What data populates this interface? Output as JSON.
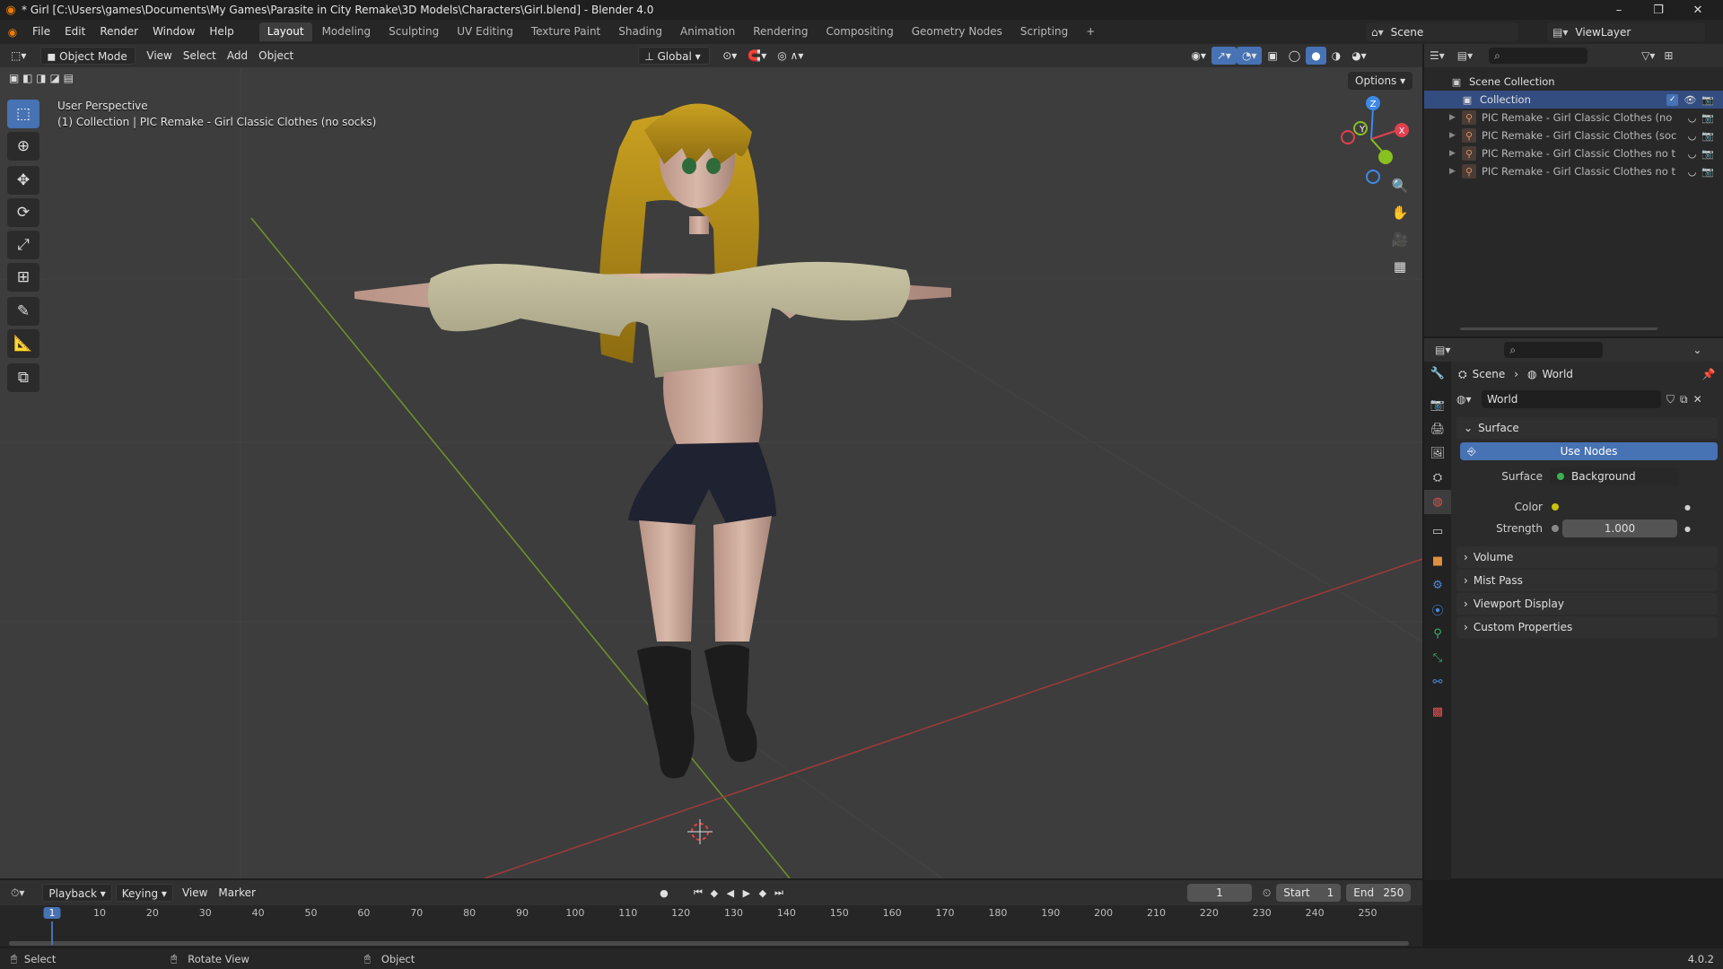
{
  "window": {
    "title": "* Girl [C:\\Users\\games\\Documents\\My Games\\Parasite in City Remake\\3D Models\\Characters\\Girl.blend] - Blender 4.0",
    "minimize": "–",
    "maximize": "❐",
    "close": "✕"
  },
  "menu": [
    "File",
    "Edit",
    "Render",
    "Window",
    "Help"
  ],
  "workspaces": [
    "Layout",
    "Modeling",
    "Sculpting",
    "UV Editing",
    "Texture Paint",
    "Shading",
    "Animation",
    "Rendering",
    "Compositing",
    "Geometry Nodes",
    "Scripting",
    "+"
  ],
  "active_workspace": "Layout",
  "scene_field": "Scene",
  "viewlayer_field": "ViewLayer",
  "viewport": {
    "mode": "Object Mode",
    "menus": [
      "View",
      "Select",
      "Add",
      "Object"
    ],
    "orientation": "Global",
    "options": "Options",
    "info_line1": "User Perspective",
    "info_line2": "(1) Collection | PIC Remake - Girl Classic Clothes (no socks)",
    "gizmo": {
      "x": "X",
      "y": "Y",
      "z": "Z"
    }
  },
  "outliner": {
    "root": "Scene Collection",
    "collection": "Collection",
    "items": [
      "PIC Remake - Girl Classic Clothes (no",
      "PIC Remake - Girl Classic Clothes (soc",
      "PIC Remake - Girl Classic Clothes no t",
      "PIC Remake - Girl Classic Clothes no t"
    ]
  },
  "properties": {
    "breadcrumb": [
      "Scene",
      "World"
    ],
    "datablock": "World",
    "surface_panel": "Surface",
    "use_nodes": "Use Nodes",
    "surface_label": "Surface",
    "surface_value": "Background",
    "color_label": "Color",
    "strength_label": "Strength",
    "strength_value": "1.000",
    "panels": [
      "Volume",
      "Mist Pass",
      "Viewport Display",
      "Custom Properties"
    ]
  },
  "timeline": {
    "menus": [
      "Playback",
      "Keying",
      "View",
      "Marker"
    ],
    "current_frame": "1",
    "start_label": "Start",
    "start_value": "1",
    "end_label": "End",
    "end_value": "250",
    "ticks": [
      "1",
      "10",
      "20",
      "30",
      "40",
      "50",
      "60",
      "70",
      "80",
      "90",
      "100",
      "110",
      "120",
      "130",
      "140",
      "150",
      "160",
      "170",
      "180",
      "190",
      "200",
      "210",
      "220",
      "230",
      "240",
      "250"
    ]
  },
  "status": {
    "select": "Select",
    "rotate": "Rotate View",
    "object": "Object",
    "version": "4.0.2"
  },
  "colors": {
    "accent": "#4772b3",
    "axis_x": "#e0404f",
    "axis_y": "#88c020",
    "axis_z": "#3d8ae8",
    "world_color": "#c9c20a"
  }
}
